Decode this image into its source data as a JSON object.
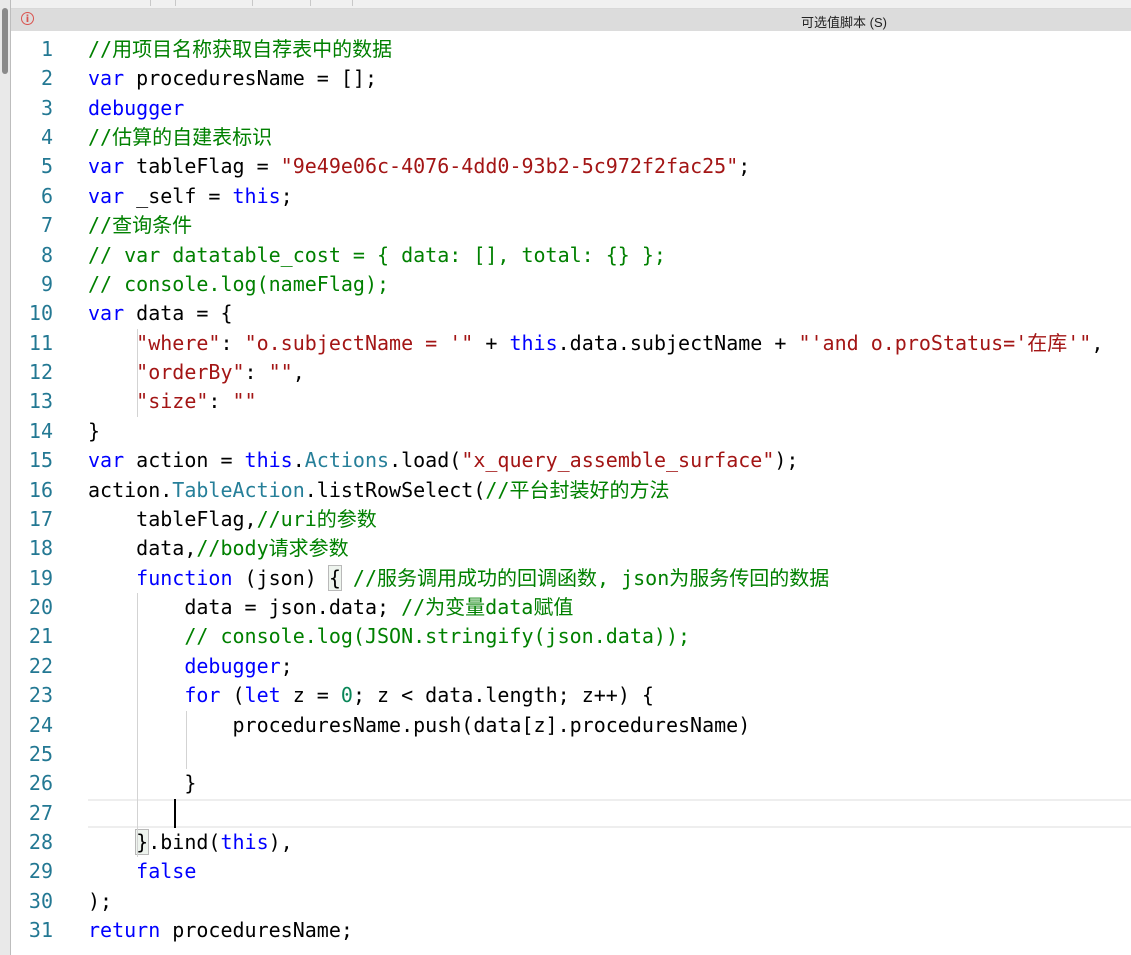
{
  "header": {
    "title": "可选值脚本 (S)",
    "icon": "info-icon"
  },
  "editor": {
    "current_line": 27,
    "lines": [
      [
        [
          "cm",
          "//用项目名称获取自荐表中的数据"
        ]
      ],
      [
        [
          "kw",
          "var"
        ],
        [
          "pl",
          " proceduresName = [];"
        ]
      ],
      [
        [
          "kw",
          "debugger"
        ]
      ],
      [
        [
          "cm",
          "//估算的自建表标识"
        ]
      ],
      [
        [
          "kw",
          "var"
        ],
        [
          "pl",
          " tableFlag = "
        ],
        [
          "str",
          "\"9e49e06c-4076-4dd0-93b2-5c972f2fac25\""
        ],
        [
          "pl",
          ";"
        ]
      ],
      [
        [
          "kw",
          "var"
        ],
        [
          "pl",
          " _self = "
        ],
        [
          "kw",
          "this"
        ],
        [
          "pl",
          ";"
        ]
      ],
      [
        [
          "cm",
          "//查询条件"
        ]
      ],
      [
        [
          "cm",
          "// var datatable_cost = { data: [], total: {} };"
        ]
      ],
      [
        [
          "cm",
          "// console.log(nameFlag);"
        ]
      ],
      [
        [
          "kw",
          "var"
        ],
        [
          "pl",
          " data = {"
        ]
      ],
      [
        [
          "pl",
          "    "
        ],
        [
          "str",
          "\"where\""
        ],
        [
          "pl",
          ": "
        ],
        [
          "str",
          "\"o.subjectName = '\""
        ],
        [
          "pl",
          " + "
        ],
        [
          "kw",
          "this"
        ],
        [
          "pl",
          ".data.subjectName + "
        ],
        [
          "str",
          "\"'and o.proStatus='在库'\""
        ],
        [
          "pl",
          ","
        ]
      ],
      [
        [
          "pl",
          "    "
        ],
        [
          "str",
          "\"orderBy\""
        ],
        [
          "pl",
          ": "
        ],
        [
          "str",
          "\"\""
        ],
        [
          "pl",
          ","
        ]
      ],
      [
        [
          "pl",
          "    "
        ],
        [
          "str",
          "\"size\""
        ],
        [
          "pl",
          ": "
        ],
        [
          "str",
          "\"\""
        ]
      ],
      [
        [
          "pl",
          "}"
        ]
      ],
      [
        [
          "kw",
          "var"
        ],
        [
          "pl",
          " action = "
        ],
        [
          "kw",
          "this"
        ],
        [
          "pl",
          "."
        ],
        [
          "type",
          "Actions"
        ],
        [
          "pl",
          ".load("
        ],
        [
          "str",
          "\"x_query_assemble_surface\""
        ],
        [
          "pl",
          ");"
        ]
      ],
      [
        [
          "pl",
          "action."
        ],
        [
          "type",
          "TableAction"
        ],
        [
          "pl",
          ".listRowSelect("
        ],
        [
          "cm",
          "//平台封装好的方法"
        ]
      ],
      [
        [
          "pl",
          "    tableFlag,"
        ],
        [
          "cm",
          "//uri的参数"
        ]
      ],
      [
        [
          "pl",
          "    data,"
        ],
        [
          "cm",
          "//body请求参数"
        ]
      ],
      [
        [
          "pl",
          "    "
        ],
        [
          "kw",
          "function"
        ],
        [
          "pl",
          " (json) "
        ],
        [
          "br",
          "{"
        ],
        [
          "pl",
          " "
        ],
        [
          "cm",
          "//服务调用成功的回调函数, json为服务传回的数据"
        ]
      ],
      [
        [
          "pl",
          "        data = json.data; "
        ],
        [
          "cm",
          "//为变量data赋值"
        ]
      ],
      [
        [
          "pl",
          "        "
        ],
        [
          "cm",
          "// console.log(JSON.stringify(json.data));"
        ]
      ],
      [
        [
          "pl",
          "        "
        ],
        [
          "kw",
          "debugger"
        ],
        [
          "pl",
          ";"
        ]
      ],
      [
        [
          "pl",
          "        "
        ],
        [
          "kw",
          "for"
        ],
        [
          "pl",
          " ("
        ],
        [
          "kw",
          "let"
        ],
        [
          "pl",
          " z = "
        ],
        [
          "num",
          "0"
        ],
        [
          "pl",
          "; z < data.length; z++) {"
        ]
      ],
      [
        [
          "pl",
          "            proceduresName.push(data[z].proceduresName)"
        ]
      ],
      [],
      [
        [
          "pl",
          "        }"
        ]
      ],
      [],
      [
        [
          "pl",
          "    "
        ],
        [
          "br",
          "}"
        ],
        [
          "pl",
          ".bind("
        ],
        [
          "kw",
          "this"
        ],
        [
          "pl",
          "),"
        ]
      ],
      [
        [
          "pl",
          "    "
        ],
        [
          "kw",
          "false"
        ]
      ],
      [
        [
          "pl",
          ");"
        ]
      ],
      [
        [
          "kw",
          "return"
        ],
        [
          "pl",
          " proceduresName;"
        ]
      ]
    ]
  }
}
